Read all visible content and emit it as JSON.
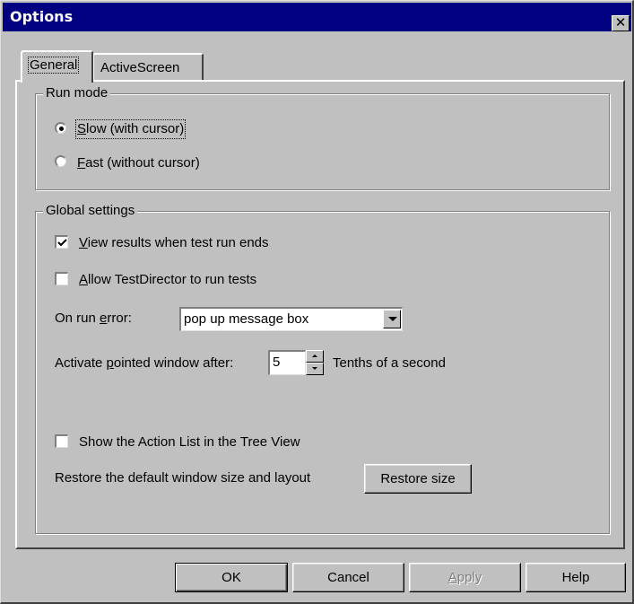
{
  "window": {
    "title": "Options",
    "close_glyph": "✕"
  },
  "tabs": [
    {
      "label": "General",
      "selected": true
    },
    {
      "label": "ActiveScreen",
      "selected": false
    }
  ],
  "run_mode": {
    "group_label": "Run mode",
    "options": [
      {
        "mnemonic": "S",
        "rest": "low (with cursor)",
        "checked": true
      },
      {
        "mnemonic": "F",
        "rest": "ast (without cursor)",
        "checked": false
      }
    ]
  },
  "global_settings": {
    "group_label": "Global settings",
    "view_results": {
      "mnemonic": "V",
      "rest": "iew results when test run ends",
      "checked": true
    },
    "allow_td": {
      "mnemonic": "A",
      "rest": "llow TestDirector to run tests",
      "checked": false
    },
    "on_run_error": {
      "pre": "On run ",
      "mnemonic": "e",
      "post": "rror:",
      "value": "pop up message box"
    },
    "activate_window": {
      "pre": "Activate ",
      "mnemonic": "p",
      "post": "ointed window after:",
      "value": "5",
      "unit": "Tenths of a second"
    },
    "show_action_list": {
      "label": "Show the Action List in the Tree View",
      "checked": false
    },
    "restore": {
      "label": "Restore the default window size and layout",
      "button": "Restore size"
    }
  },
  "footer": {
    "ok": "OK",
    "cancel": "Cancel",
    "apply": {
      "mnemonic": "A",
      "rest": "pply"
    },
    "help": "Help"
  },
  "colors": {
    "titlebar": "#000080",
    "face": "#c0c0c0",
    "disabled_text": "#808080"
  }
}
